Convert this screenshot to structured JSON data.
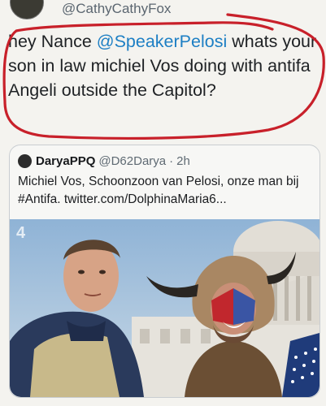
{
  "outer_tweet": {
    "handle": "@CathyCathyFox",
    "text_before_mention": "hey Nance ",
    "mention": "@SpeakerPelosi",
    "text_after_mention": " whats your son in law michiel Vos doing with antifa Angeli outside the Capitol?"
  },
  "quoted_tweet": {
    "display_name": "DaryaPPQ",
    "handle": "@D62Darya",
    "separator": "·",
    "time": "2h",
    "text": "Michiel Vos, Schoonzoon van Pelosi, onze man bij #Antifa. twitter.com/DolphinaMaria6..."
  },
  "photo": {
    "watermark": "4"
  },
  "colors": {
    "mention": "#1d7fc4",
    "highlight_loop": "#c8202a"
  }
}
